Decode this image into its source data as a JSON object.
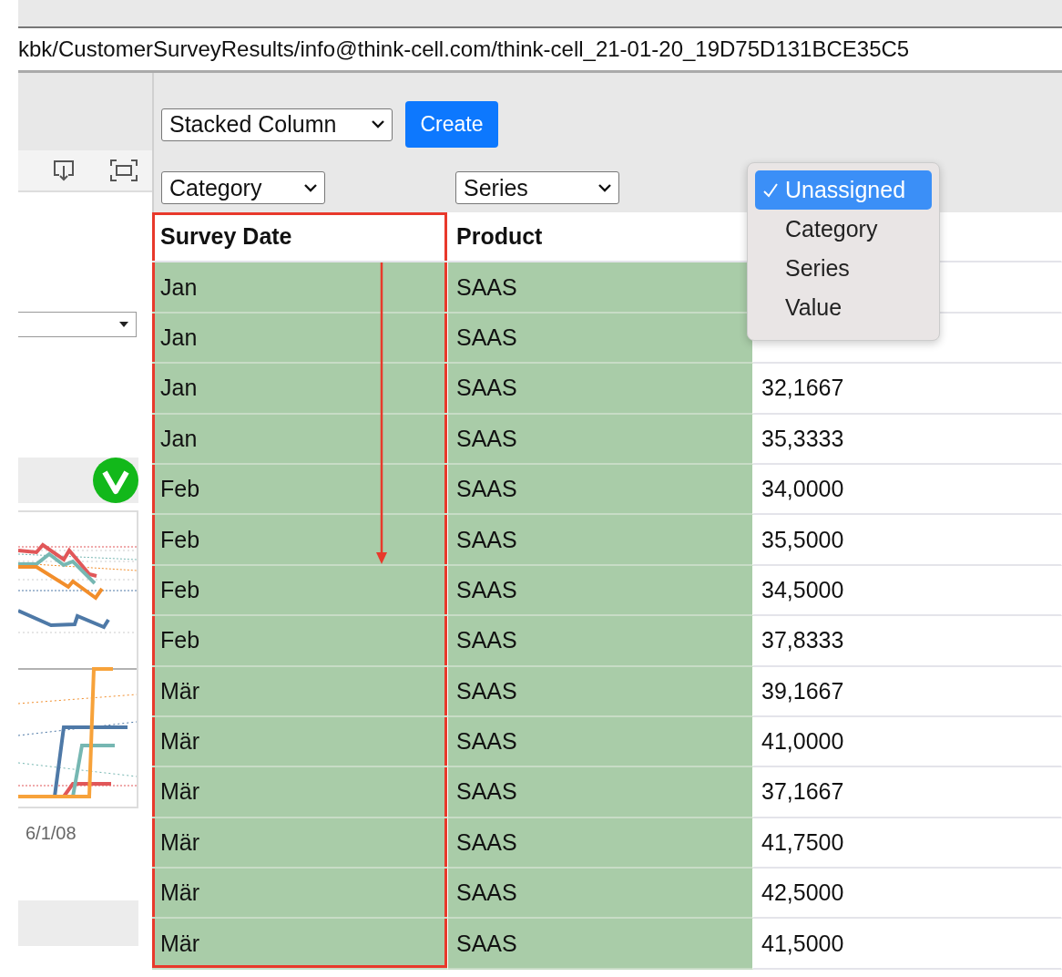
{
  "address_bar": {
    "url": "kbk/CustomerSurveyResults/info@think-cell.com/think-cell_21-01-20_19D75D131BCE35C5"
  },
  "sidebar": {
    "date_label": "6/1/08"
  },
  "toolbar": {
    "chart_type": "Stacked Column",
    "create_button": "Create"
  },
  "column_roles": [
    {
      "value": "Category"
    },
    {
      "value": "Series"
    }
  ],
  "role_menu": {
    "items": [
      {
        "label": "Unassigned",
        "selected": true
      },
      {
        "label": "Category",
        "selected": false
      },
      {
        "label": "Series",
        "selected": false
      },
      {
        "label": "Value",
        "selected": false
      }
    ]
  },
  "table": {
    "columns": [
      {
        "label": "Survey Date",
        "assigned": true,
        "highlighted": true
      },
      {
        "label": "Product",
        "assigned": true,
        "highlighted": false
      },
      {
        "assigned": false,
        "highlighted": false
      }
    ],
    "rows": [
      {
        "cells": [
          "Jan",
          "SAAS"
        ]
      },
      {
        "cells": [
          "Jan",
          "SAAS"
        ]
      },
      {
        "cells": [
          "Jan",
          "SAAS",
          "32,1667"
        ]
      },
      {
        "cells": [
          "Jan",
          "SAAS",
          "35,3333"
        ]
      },
      {
        "cells": [
          "Feb",
          "SAAS",
          "34,0000"
        ]
      },
      {
        "cells": [
          "Feb",
          "SAAS",
          "35,5000"
        ]
      },
      {
        "cells": [
          "Feb",
          "SAAS",
          "34,5000"
        ]
      },
      {
        "cells": [
          "Feb",
          "SAAS",
          "37,8333"
        ]
      },
      {
        "cells": [
          "Mär",
          "SAAS",
          "39,1667"
        ]
      },
      {
        "cells": [
          "Mär",
          "SAAS",
          "41,0000"
        ]
      },
      {
        "cells": [
          "Mär",
          "SAAS",
          "37,1667"
        ]
      },
      {
        "cells": [
          "Mär",
          "SAAS",
          "41,7500"
        ]
      },
      {
        "cells": [
          "Mär",
          "SAAS",
          "42,5000"
        ]
      },
      {
        "cells": [
          "Mär",
          "SAAS",
          "41,5000"
        ]
      }
    ]
  }
}
